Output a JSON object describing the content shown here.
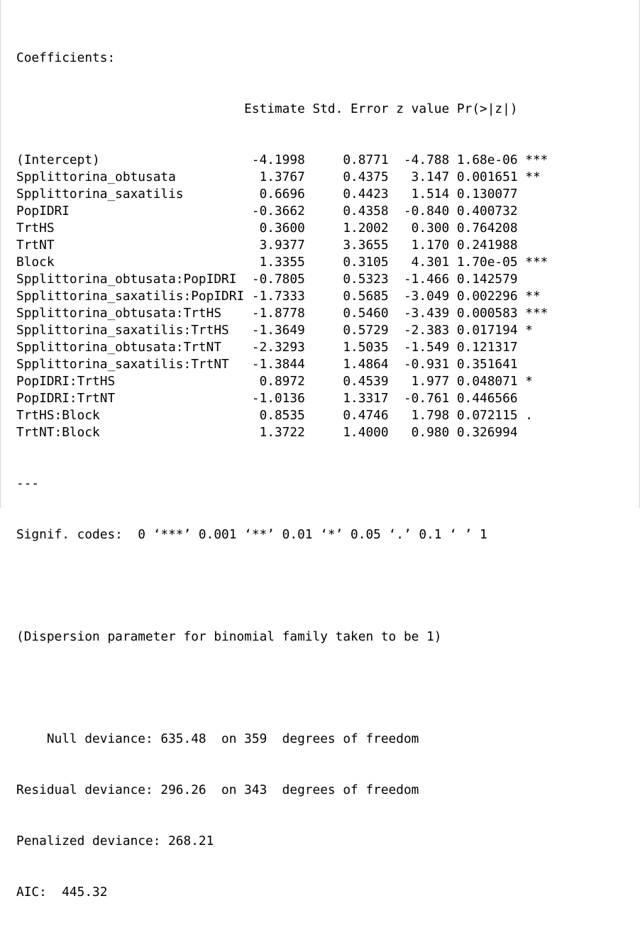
{
  "console": {
    "coefficients_header": "Coefficients:",
    "column_header": "                              Estimate Std. Error z value Pr(>|z|)    ",
    "rows": [
      "(Intercept)                    -4.1998     0.8771  -4.788 1.68e-06 ***",
      "Spplittorina_obtusata           1.3767     0.4375   3.147 0.001651 ** ",
      "Spplittorina_saxatilis          0.6696     0.4423   1.514 0.130077    ",
      "PopIDRI                        -0.3662     0.4358  -0.840 0.400732    ",
      "TrtHS                           0.3600     1.2002   0.300 0.764208    ",
      "TrtNT                           3.9377     3.3655   1.170 0.241988    ",
      "Block                           1.3355     0.3105   4.301 1.70e-05 ***",
      "Spplittorina_obtusata:PopIDRI  -0.7805     0.5323  -1.466 0.142579    ",
      "Spplittorina_saxatilis:PopIDRI -1.7333     0.5685  -3.049 0.002296 ** ",
      "Spplittorina_obtusata:TrtHS    -1.8778     0.5460  -3.439 0.000583 ***",
      "Spplittorina_saxatilis:TrtHS   -1.3649     0.5729  -2.383 0.017194 *  ",
      "Spplittorina_obtusata:TrtNT    -2.3293     1.5035  -1.549 0.121317    ",
      "Spplittorina_saxatilis:TrtNT   -1.3844     1.4864  -0.931 0.351641    ",
      "PopIDRI:TrtHS                   0.8972     0.4539   1.977 0.048071 *  ",
      "PopIDRI:TrtNT                  -1.0136     1.3317  -0.761 0.446566    ",
      "TrtHS:Block                     0.8535     0.4746   1.798 0.072115 .  ",
      "TrtNT:Block                     1.3722     1.4000   0.980 0.326994    "
    ],
    "separator": "---",
    "signif_codes": "Signif. codes:  0 ‘***’ 0.001 ‘**’ 0.01 ‘*’ 0.05 ‘.’ 0.1 ‘ ’ 1",
    "dispersion": "(Dispersion parameter for binomial family taken to be 1)",
    "null_deviance": "    Null deviance: 635.48  on 359  degrees of freedom",
    "residual_deviance": "Residual deviance: 296.26  on 343  degrees of freedom",
    "penalized_deviance": "Penalized deviance: 268.21",
    "aic": "AIC:  445.32"
  }
}
